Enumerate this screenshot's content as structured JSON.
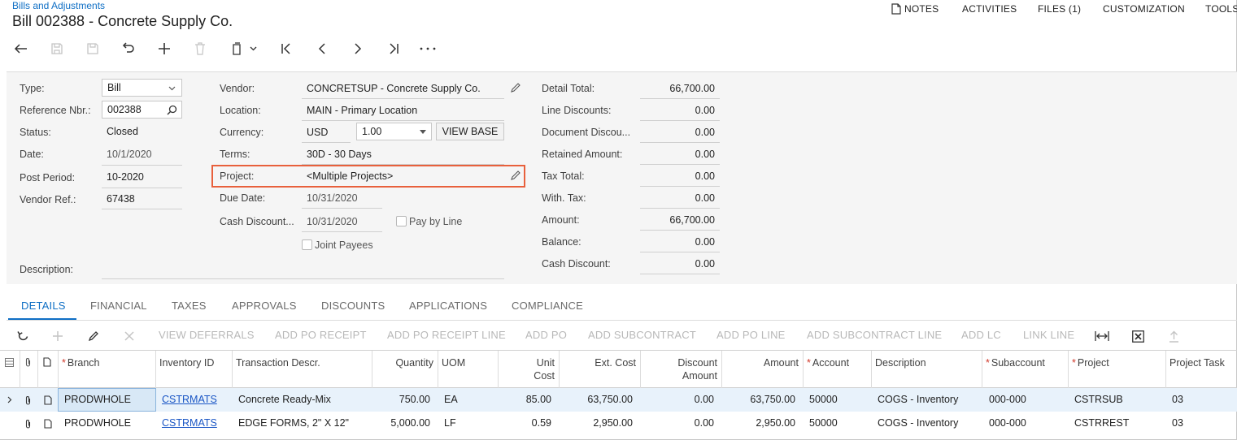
{
  "header": {
    "breadcrumb": "Bills and Adjustments",
    "title": "Bill 002388 - Concrete Supply Co.",
    "links": [
      {
        "label": "NOTES",
        "icon": "note-icon"
      },
      {
        "label": "ACTIVITIES"
      },
      {
        "label": "FILES (1)"
      },
      {
        "label": "CUSTOMIZATION"
      },
      {
        "label": "TOOLS"
      }
    ]
  },
  "toolbar": [
    "back-icon",
    "save-close-icon",
    "save-icon",
    "undo-icon",
    "add-icon",
    "delete-icon",
    "copy-paste-icon",
    "first-icon",
    "previous-icon",
    "next-icon",
    "last-icon",
    "more-icon"
  ],
  "form": {
    "type_label": "Type:",
    "type_value": "Bill",
    "refnbr_label": "Reference Nbr.:",
    "refnbr_value": "002388",
    "status_label": "Status:",
    "status_value": "Closed",
    "date_label": "Date:",
    "date_value": "10/1/2020",
    "postperiod_label": "Post Period:",
    "postperiod_value": "10-2020",
    "vendorref_label": "Vendor Ref.:",
    "vendorref_value": "67438",
    "description_label": "Description:",
    "description_value": "",
    "vendor_label": "Vendor:",
    "vendor_value": "CONCRETSUP - Concrete Supply Co.",
    "location_label": "Location:",
    "location_value": "MAIN - Primary Location",
    "currency_label": "Currency:",
    "currency_value": "USD",
    "rate_value": "1.00",
    "viewbase_label": "VIEW BASE",
    "terms_label": "Terms:",
    "terms_value": "30D - 30 Days",
    "project_label": "Project:",
    "project_value": "<Multiple Projects>",
    "duedate_label": "Due Date:",
    "duedate_value": "10/31/2020",
    "cashdisc_label": "Cash Discount...",
    "cashdisc_value": "10/31/2020",
    "paybyline_label": "Pay by Line",
    "jointpayees_label": "Joint Payees",
    "totals": [
      {
        "label": "Detail Total:",
        "value": "66,700.00"
      },
      {
        "label": "Line Discounts:",
        "value": "0.00"
      },
      {
        "label": "Document Discou...",
        "value": "0.00"
      },
      {
        "label": "Retained Amount:",
        "value": "0.00"
      },
      {
        "label": "Tax Total:",
        "value": "0.00"
      },
      {
        "label": "With. Tax:",
        "value": "0.00"
      },
      {
        "label": "Amount:",
        "value": "66,700.00"
      },
      {
        "label": "Balance:",
        "value": "0.00"
      },
      {
        "label": "Cash Discount:",
        "value": "0.00"
      }
    ]
  },
  "tabs": [
    "DETAILS",
    "FINANCIAL",
    "TAXES",
    "APPROVALS",
    "DISCOUNTS",
    "APPLICATIONS",
    "COMPLIANCE"
  ],
  "grid_toolbar": [
    "VIEW DEFERRALS",
    "ADD PO RECEIPT",
    "ADD PO RECEIPT LINE",
    "ADD PO",
    "ADD SUBCONTRACT",
    "ADD PO LINE",
    "ADD SUBCONTRACT LINE",
    "ADD LC",
    "LINK LINE"
  ],
  "grid": {
    "columns": {
      "branch": "Branch",
      "inventory": "Inventory ID",
      "descr": "Transaction Descr.",
      "qty": "Quantity",
      "uom": "UOM",
      "unitcost_1": "Unit",
      "unitcost_2": "Cost",
      "extcost": "Ext. Cost",
      "disc_1": "Discount",
      "disc_2": "Amount",
      "amount": "Amount",
      "account": "Account",
      "description": "Description",
      "subaccount": "Subaccount",
      "project": "Project",
      "task": "Project Task"
    },
    "rows": [
      {
        "branch": "PRODWHOLE",
        "inventory": "CSTRMATS",
        "descr": "Concrete Ready-Mix",
        "qty": "750.00",
        "uom": "EA",
        "unitcost": "85.00",
        "extcost": "63,750.00",
        "disc": "0.00",
        "amount": "63,750.00",
        "account": "50000",
        "description": "COGS - Inventory",
        "subaccount": "000-000",
        "project": "CSTRSUB",
        "task": "03"
      },
      {
        "branch": "PRODWHOLE",
        "inventory": "CSTRMATS",
        "descr": "EDGE FORMS, 2\" X 12\"",
        "qty": "5,000.00",
        "uom": "LF",
        "unitcost": "0.59",
        "extcost": "2,950.00",
        "disc": "0.00",
        "amount": "2,950.00",
        "account": "50000",
        "description": "COGS - Inventory",
        "subaccount": "000-000",
        "project": "CSTRREST",
        "task": "03"
      }
    ]
  },
  "colors": {
    "accent": "#0f6fc5",
    "highlight": "#e8603c",
    "selected_row": "#e8f2fb"
  }
}
